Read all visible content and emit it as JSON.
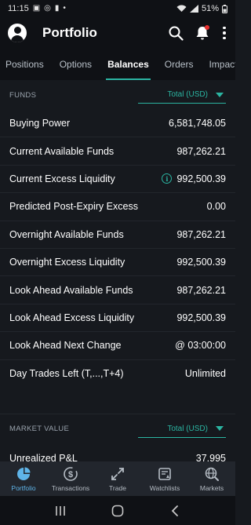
{
  "status_bar": {
    "time": "11:15",
    "battery": "51%"
  },
  "header": {
    "title": "Portfolio"
  },
  "tabs": [
    {
      "label": "Positions",
      "active": false
    },
    {
      "label": "Options",
      "active": false
    },
    {
      "label": "Balances",
      "active": true
    },
    {
      "label": "Orders",
      "active": false
    },
    {
      "label": "Impact Len",
      "active": false
    }
  ],
  "funds": {
    "label": "FUNDS",
    "currency": "Total (USD)",
    "rows": [
      {
        "label": "Buying Power",
        "value": "6,581,748.05"
      },
      {
        "label": "Current Available Funds",
        "value": "987,262.21"
      },
      {
        "label": "Current Excess Liquidity",
        "value": "992,500.39",
        "info": true
      },
      {
        "label": "Predicted Post-Expiry Excess",
        "value": "0.00"
      },
      {
        "label": "Overnight Available Funds",
        "value": "987,262.21"
      },
      {
        "label": "Overnight Excess Liquidity",
        "value": "992,500.39"
      },
      {
        "label": "Look Ahead Available Funds",
        "value": "987,262.21"
      },
      {
        "label": "Look Ahead Excess Liquidity",
        "value": "992,500.39"
      },
      {
        "label": "Look Ahead Next Change",
        "value": "@ 03:00:00"
      },
      {
        "label": "Day Trades Left (T,...,T+4)",
        "value": "Unlimited"
      }
    ]
  },
  "market_value": {
    "label": "MARKET VALUE",
    "currency": "Total (USD)",
    "rows": [
      {
        "label": "Unrealized P&L",
        "value": "37,995"
      }
    ]
  },
  "bottom_nav": [
    {
      "label": "Portfolio",
      "icon": "pie-chart-icon",
      "active": true
    },
    {
      "label": "Transactions",
      "icon": "dollar-circle-icon",
      "active": false
    },
    {
      "label": "Trade",
      "icon": "trade-arrows-icon",
      "active": false
    },
    {
      "label": "Watchlists",
      "icon": "watchlist-icon",
      "active": false
    },
    {
      "label": "Markets",
      "icon": "globe-search-icon",
      "active": false
    }
  ],
  "colors": {
    "accent": "#2bb5a2",
    "nav_active": "#5fb4e8",
    "background": "#16191e"
  }
}
